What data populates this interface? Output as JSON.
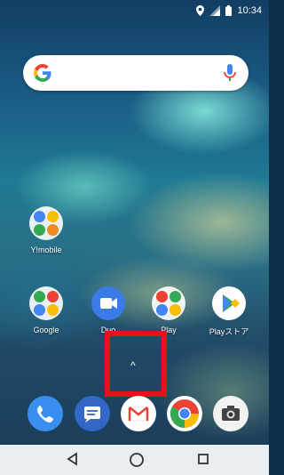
{
  "status_bar": {
    "time": "10:34",
    "icons": [
      "location-icon",
      "signal-icon",
      "battery-icon"
    ]
  },
  "search_widget": {
    "logo": "G",
    "icons": [
      "google-logo-icon",
      "mic-icon"
    ]
  },
  "home_apps": [
    {
      "label": "Y!mobile",
      "icon": "folder-icon"
    },
    {
      "label": "Google",
      "icon": "folder-icon"
    },
    {
      "label": "Duo",
      "icon": "video-call-icon"
    },
    {
      "label": "Play",
      "icon": "folder-icon"
    },
    {
      "label": "Playストア",
      "icon": "play-store-icon"
    }
  ],
  "app_drawer_handle": {
    "glyph": "^"
  },
  "dock": [
    {
      "icon": "phone-icon"
    },
    {
      "icon": "messages-icon"
    },
    {
      "icon": "gmail-icon"
    },
    {
      "icon": "chrome-icon"
    },
    {
      "icon": "camera-icon"
    }
  ],
  "nav_bar": {
    "icons": [
      "back-icon",
      "home-icon",
      "recents-icon"
    ]
  },
  "colors": {
    "highlight_border": "#e8101a",
    "nav_bar_bg": "#e9eef2"
  }
}
